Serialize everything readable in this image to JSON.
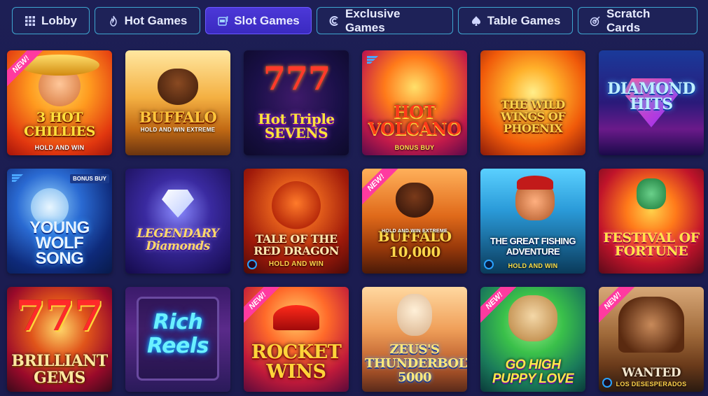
{
  "tabs": [
    {
      "label": "Lobby",
      "icon": "grid-icon",
      "active": false
    },
    {
      "label": "Hot Games",
      "icon": "flame-icon",
      "active": false
    },
    {
      "label": "Slot Games",
      "icon": "slot-machine-icon",
      "active": true
    },
    {
      "label": "Exclusive Games",
      "icon": "exclusive-icon",
      "active": false
    },
    {
      "label": "Table Games",
      "icon": "spade-icon",
      "active": false
    },
    {
      "label": "Scratch Cards",
      "icon": "target-icon",
      "active": false
    }
  ],
  "badges": {
    "new": "NEW!",
    "bonus_buy": "BONUS BUY"
  },
  "games": [
    {
      "title": "3 HOT CHILLIES",
      "sub": "HOLD AND WIN"
    },
    {
      "title": "BUFFALO",
      "sub": "HOLD AND WIN EXTREME"
    },
    {
      "title": "Hot Triple SEVENS",
      "sub": ""
    },
    {
      "title": "HOT VOLCANO",
      "sub": "BONUS BUY"
    },
    {
      "title": "THE WILD WINGS OF PHOENIX",
      "sub": ""
    },
    {
      "title": "DIAMOND HITS",
      "sub": ""
    },
    {
      "title": "YOUNG WOLF SONG",
      "sub": ""
    },
    {
      "title": "LEGENDARY Diamonds",
      "sub": ""
    },
    {
      "title": "TALE OF THE RED DRAGON",
      "sub": "HOLD AND WIN"
    },
    {
      "title": "BUFFALO 10,000",
      "sub": "HOLD AND WIN EXTREME"
    },
    {
      "title": "THE GREAT FISHING ADVENTURE",
      "sub": "HOLD AND WIN"
    },
    {
      "title": "FESTIVAL OF FORTUNE",
      "sub": ""
    },
    {
      "title": "BRILLIANT GEMS",
      "sub": ""
    },
    {
      "title": "Rich Reels",
      "sub": ""
    },
    {
      "title": "ROCKET WINS",
      "sub": ""
    },
    {
      "title": "ZEUS'S THUNDERBOLT 5000",
      "sub": ""
    },
    {
      "title": "GO HIGH PUPPY LOVE",
      "sub": ""
    },
    {
      "title": "WANTED",
      "sub": "LOS DESESPERADOS"
    }
  ]
}
